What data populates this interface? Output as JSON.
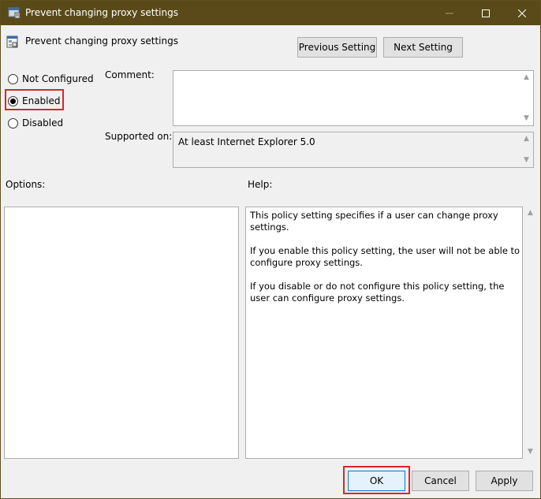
{
  "window": {
    "title": "Prevent changing proxy settings",
    "controls": {
      "minimize_icon": "minimize-icon",
      "maximize_icon": "maximize-icon",
      "close_icon": "close-icon"
    }
  },
  "header": {
    "title": "Prevent changing proxy settings",
    "previous_setting_label": "Previous Setting",
    "next_setting_label": "Next Setting"
  },
  "state": {
    "options": [
      {
        "label": "Not Configured",
        "selected": false
      },
      {
        "label": "Enabled",
        "selected": true
      },
      {
        "label": "Disabled",
        "selected": false
      }
    ]
  },
  "comment": {
    "label": "Comment:",
    "value": ""
  },
  "supported": {
    "label": "Supported on:",
    "value": "At least Internet Explorer 5.0"
  },
  "options_pane": {
    "label": "Options:"
  },
  "help_pane": {
    "label": "Help:",
    "paragraphs": [
      "This policy setting specifies if a user can change proxy settings.",
      "If you enable this policy setting, the user will not be able to configure proxy settings.",
      "If you disable or do not configure this policy setting, the user can configure proxy settings."
    ]
  },
  "footer": {
    "ok_label": "OK",
    "cancel_label": "Cancel",
    "apply_label": "Apply"
  },
  "colors": {
    "titlebar": "#5a4a19",
    "highlight": "#d9262b",
    "focus_border": "#0078d7"
  }
}
